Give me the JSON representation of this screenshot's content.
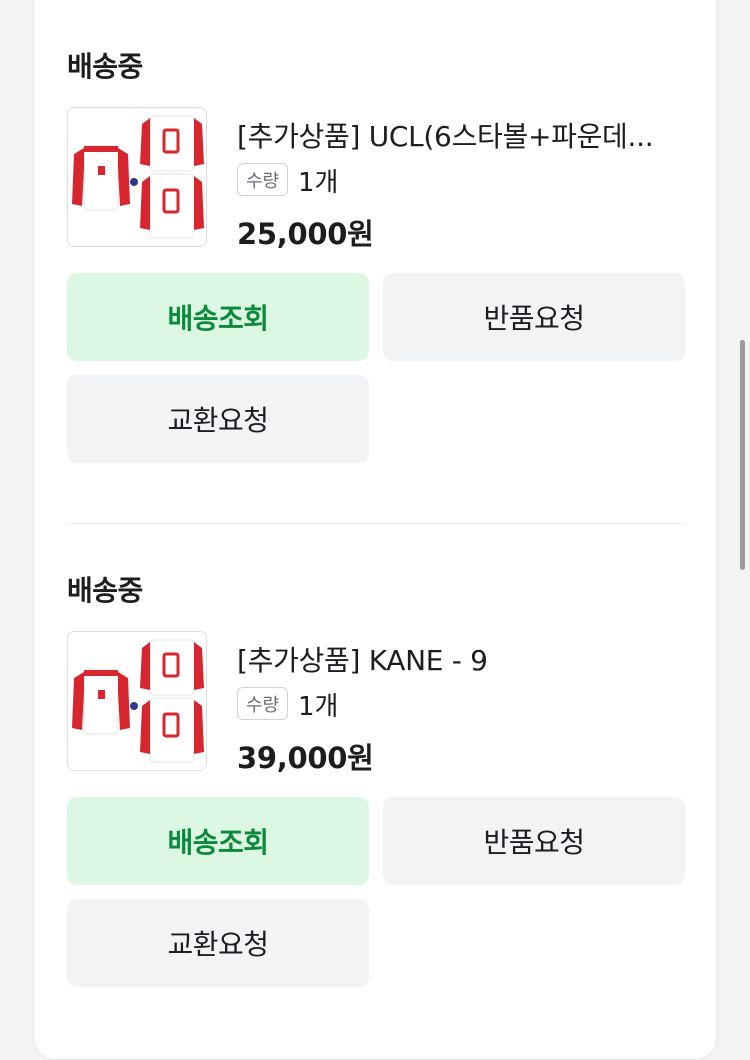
{
  "orders": [
    {
      "status": "배송중",
      "product_name": "[추가상품] UCL(6스타볼+파운데...",
      "qty_label": "수량",
      "qty_value": "1개",
      "price": "25,000원",
      "buttons": {
        "track": "배송조회",
        "return": "반품요청",
        "exchange": "교환요청"
      },
      "thumbnail_icon": "jersey-product-icon"
    },
    {
      "status": "배송중",
      "product_name": "[추가상품] KANE - 9",
      "qty_label": "수량",
      "qty_value": "1개",
      "price": "39,000원",
      "buttons": {
        "track": "배송조회",
        "return": "반품요청",
        "exchange": "교환요청"
      },
      "thumbnail_icon": "jersey-product-icon"
    }
  ],
  "colors": {
    "track_button_bg": "#dcf8e3",
    "track_button_text": "#0c8a3b",
    "secondary_button_bg": "#f2f3f5",
    "jersey_red": "#d7262e"
  }
}
